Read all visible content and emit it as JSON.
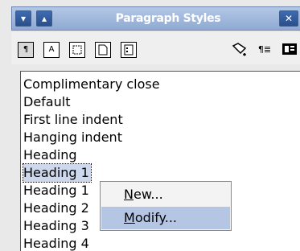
{
  "window": {
    "title": "Paragraph Styles",
    "menu_icon": "chevron-down-icon",
    "shade_icon": "chevron-up-icon",
    "close_icon": "close-icon",
    "accent": "#2a4f8a"
  },
  "toolbar": {
    "buttons": [
      {
        "icon": "paragraph-styles-icon",
        "glyph": "¶",
        "active": true
      },
      {
        "icon": "character-styles-icon",
        "glyph": "A",
        "active": false
      },
      {
        "icon": "frame-styles-icon",
        "glyph": "",
        "active": false
      },
      {
        "icon": "page-styles-icon",
        "glyph": "",
        "active": false
      },
      {
        "icon": "list-styles-icon",
        "glyph": "",
        "active": false
      }
    ],
    "fill_format_icon": "fill-format-icon",
    "new_style_icon": "new-style-from-selection-icon",
    "update_style_icon": "update-style-icon"
  },
  "styles": {
    "items": [
      "Complimentary close",
      "Default",
      "First line indent",
      "Hanging indent",
      "Heading",
      "Heading 1",
      "Heading 1",
      "Heading 2",
      "Heading 3",
      "Heading 4"
    ],
    "selected_index": 5,
    "selection_color": "#cdd8ec"
  },
  "context_menu": {
    "new_label_first": "N",
    "new_label_rest": "ew...",
    "modify_label_first": "M",
    "modify_label_rest": "odify...",
    "highlight_color": "#b4c6e4"
  }
}
